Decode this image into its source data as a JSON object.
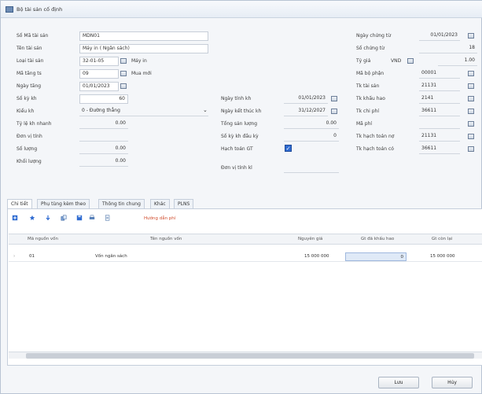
{
  "window": {
    "title": "Bộ tài sản cố định"
  },
  "left": {
    "ma_tai_san": {
      "label": "Số Mã tài sản",
      "value": "MDN01"
    },
    "ten_tai_san": {
      "label": "Tên tài sản",
      "value": "Máy in ( Ngân sách)"
    },
    "loai_tai_san": {
      "label": "Loại tài sản",
      "value": "32-01-05",
      "desc": "Máy in"
    },
    "ma_tang_ts": {
      "label": "Mã tăng ts",
      "value": "09",
      "desc": "Mua mới"
    },
    "ngay_tang": {
      "label": "Ngày tăng",
      "value": "01/01/2023"
    },
    "so_ky_kh": {
      "label": "Số kỳ kh",
      "value": "60"
    },
    "kieu_kh": {
      "label": "Kiểu kh",
      "value": "0 - Đường thẳng"
    },
    "ty_le_kh": {
      "label": "Tỷ lệ kh nhanh",
      "value": "0.00"
    },
    "don_vi_tinh": {
      "label": "Đơn vị tính",
      "value": ""
    },
    "so_luong": {
      "label": "Số lượng",
      "value": "0.00"
    },
    "khoi_luong": {
      "label": "Khối lượng",
      "value": "0.00"
    }
  },
  "middle": {
    "ngay_tinh_kh": {
      "label": "Ngày tính kh",
      "value": "01/01/2023"
    },
    "ngay_ket_thuc_kh": {
      "label": "Ngày kết thúc kh",
      "value": "31/12/2027"
    },
    "tong_san_luong": {
      "label": "Tổng sản lượng",
      "value": "0.00"
    },
    "so_ky_kh_dau_ky": {
      "label": "Số kỳ kh đầu kỳ",
      "value": "0"
    },
    "hach_toan_gt": {
      "label": "Hạch toán GT",
      "checked": true
    },
    "don_vi_tinh_kl": {
      "label": "Đơn vị tính kl",
      "value": ""
    }
  },
  "right": {
    "ngay_chung_tu": {
      "label": "Ngày chứng từ",
      "value": "01/01/2023"
    },
    "so_chung_tu": {
      "label": "Số chứng từ",
      "value": "18"
    },
    "ty_gia": {
      "label": "Tỷ giá",
      "currency": "VND",
      "value": "1.00"
    },
    "ma_bo_phan": {
      "label": "Mã bộ phận",
      "value": "00001"
    },
    "tk_tai_san": {
      "label": "Tk tài sản",
      "value": "21131"
    },
    "tk_khau_hao": {
      "label": "Tk khấu hao",
      "value": "2141"
    },
    "tk_chi_phi": {
      "label": "Tk chi phí",
      "value": "36611"
    },
    "ma_phi": {
      "label": "Mã phí",
      "value": ""
    },
    "tk_hach_toan_no": {
      "label": "Tk hạch toán nợ",
      "value": "21131"
    },
    "tk_hach_toan_co": {
      "label": "Tk hạch toán có",
      "value": "36611"
    }
  },
  "tabs": [
    "Chi tiết",
    "Phụ tùng kèm theo",
    "Thông tin chung",
    "Khác",
    "PLNS"
  ],
  "toolbar": {
    "items": [
      "add",
      "star",
      "down",
      "copy",
      "save",
      "print",
      "export"
    ],
    "hint": "Hướng dẫn phí"
  },
  "grid": {
    "columns": [
      "Mã nguồn vốn",
      "Tên nguồn vốn",
      "Nguyên giá",
      "Gt đã khấu hao",
      "Gt còn lại"
    ],
    "rows": [
      {
        "ma": "01",
        "ten": "Vốn ngân sách",
        "nguyen_gia": "15 000 000",
        "gt_kh": "0",
        "gt_con_lai": "15 000 000"
      }
    ]
  },
  "buttons": {
    "save": "Lưu",
    "cancel": "Hủy"
  }
}
